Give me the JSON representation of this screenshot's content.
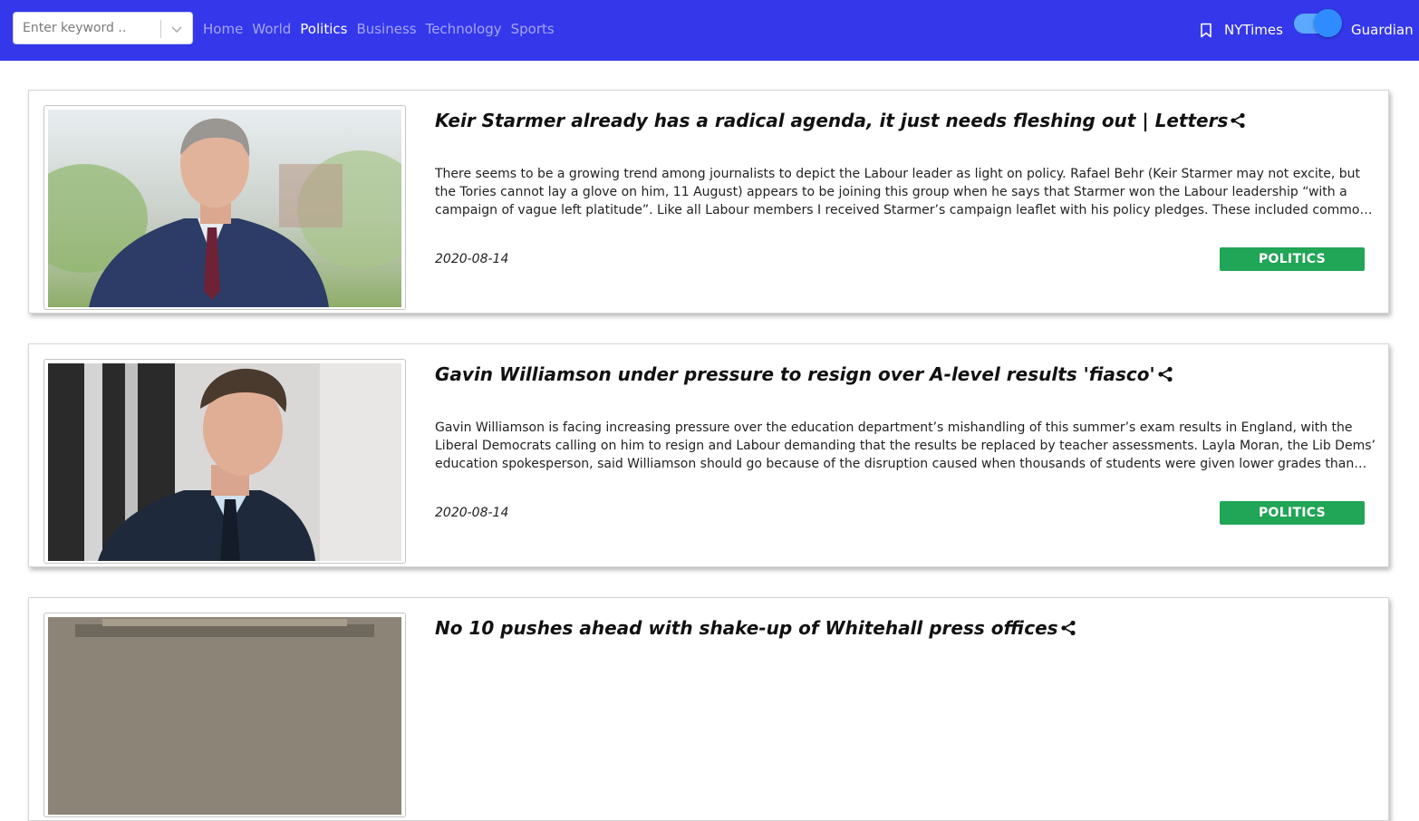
{
  "navbar": {
    "search": {
      "placeholder": "Enter keyword ..",
      "value": ""
    },
    "links": [
      {
        "label": "Home",
        "active": false
      },
      {
        "label": "World",
        "active": false
      },
      {
        "label": "Politics",
        "active": true
      },
      {
        "label": "Business",
        "active": false
      },
      {
        "label": "Technology",
        "active": false
      },
      {
        "label": "Sports",
        "active": false
      }
    ],
    "bookmark_icon": "bookmark-icon",
    "source_left": "NYTimes",
    "source_right": "Guardian",
    "toggle_on": true,
    "colors": {
      "bar": "#3437ea",
      "toggle_track": "#5aa9ff",
      "toggle_knob": "#2f8cff"
    }
  },
  "articles": [
    {
      "title": "Keir Starmer already has a radical agenda, it just needs fleshing out | Letters",
      "description": "There seems to be a growing trend among journalists to depict the Labour leader as light on policy. Rafael Behr (Keir Starmer may not excite, but the Tories cannot lay a glove on him, 11 August) appears to be joining this group when he says that Starmer won the Labour leadership “with a campaign of vague left platitude”. Like all Labour members I received Starmer’s campaign leaflet with his policy pledges. These included common ownership of rail, mail, energy and water, and the abolition of universal credit.",
      "date": "2020-08-14",
      "section": "POLITICS",
      "image": "photo of a man in a suit outdoors",
      "share_icon": "share-icon"
    },
    {
      "title": "Gavin Williamson under pressure to resign over A-level results 'fiasco'",
      "description": "Gavin Williamson is facing increasing pressure over the education department’s mishandling of this summer’s exam results in England, with the Liberal Democrats calling on him to resign and Labour demanding that the results be replaced by teacher assessments. Layla Moran, the Lib Dems’ education spokesperson, said Williamson should go because of the disruption caused when thousands of students were given lower grades than their teachers had predicted.",
      "date": "2020-08-14",
      "section": "POLITICS",
      "image": "photo of a man in a suit in front of railings",
      "share_icon": "share-icon"
    },
    {
      "title": "No 10 pushes ahead with shake-up of Whitehall press offices",
      "share_icon": "share-icon"
    }
  ],
  "colors": {
    "badge": "#21a556"
  }
}
